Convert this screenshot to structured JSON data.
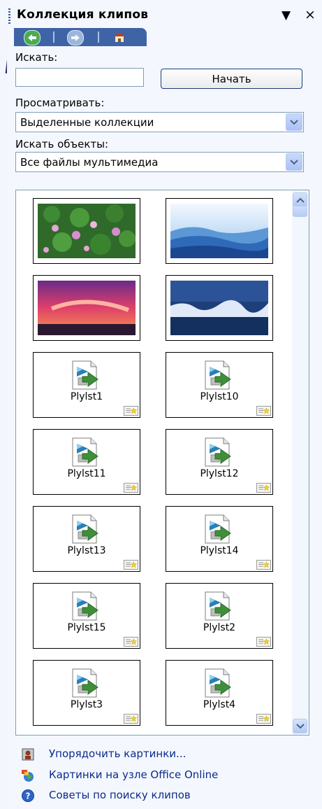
{
  "pane": {
    "title": "Коллекция клипов",
    "menu_glyph": "▼",
    "close_glyph": "×"
  },
  "nav": {
    "back_icon": "back-arrow-icon",
    "forward_icon": "forward-arrow-icon",
    "home_icon": "home-icon"
  },
  "search": {
    "label": "Искать:",
    "value": "",
    "button_label": "Начать"
  },
  "browse": {
    "label": "Просматривать:",
    "selected": "Выделенные коллекции"
  },
  "objects": {
    "label": "Искать объекты:",
    "selected": "Все файлы мультимедиа"
  },
  "clips": {
    "images": [
      {
        "icon": "water-lilies-image"
      },
      {
        "icon": "blue-hills-image"
      },
      {
        "icon": "sunset-image"
      },
      {
        "icon": "winter-image"
      }
    ],
    "playlists": [
      "Plylst1",
      "Plylst10",
      "Plylst11",
      "Plylst12",
      "Plylst13",
      "Plylst14",
      "Plylst15",
      "Plylst2",
      "Plylst3",
      "Plylst4"
    ]
  },
  "tasks": {
    "organize": "Упорядочить картинки...",
    "online": "Картинки на узле Office Online",
    "tips": "Советы по поиску клипов"
  },
  "colors": {
    "nav_bar": "#3f64a5",
    "link": "#0c2a8a",
    "dropdown_button": "#b5cbf5"
  }
}
